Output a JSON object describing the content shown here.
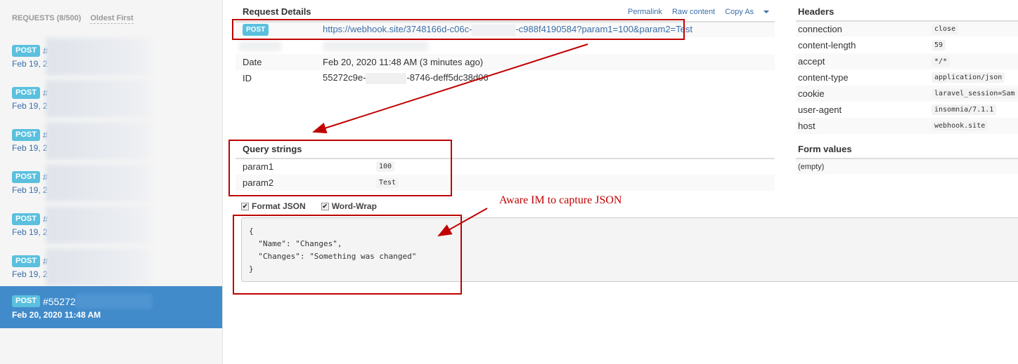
{
  "sidebar": {
    "title": "REQUESTS (8/500)",
    "sort_label": "Oldest First",
    "items": [
      {
        "method": "POST",
        "number": "#",
        "date": "Feb 19, 2"
      },
      {
        "method": "POST",
        "number": "#",
        "date": "Feb 19, 2"
      },
      {
        "method": "POST",
        "number": "#",
        "date": "Feb 19, 2"
      },
      {
        "method": "POST",
        "number": "#",
        "date": "Feb 19, 2"
      },
      {
        "method": "POST",
        "number": "#",
        "date": "Feb 19, 2"
      },
      {
        "method": "POST",
        "number": "#",
        "date": "Feb 19, 2"
      },
      {
        "method": "POST",
        "number": "#55272",
        "date": "Feb 20, 2020 11:48 AM",
        "active": true
      }
    ]
  },
  "request_details": {
    "title": "Request Details",
    "links": {
      "permalink": "Permalink",
      "raw_content": "Raw content",
      "copy_as": "Copy As"
    },
    "method": "POST",
    "url_prefix": "https://webhook.site/3748166d-c06c-",
    "url_suffix": "-c988f4190584?param1=100&param2=Test",
    "date_label": "Date",
    "date_value": "Feb 20, 2020 11:48 AM (3 minutes ago)",
    "id_label": "ID",
    "id_prefix": "55272c9e-",
    "id_suffix": "-8746-deff5dc38d06"
  },
  "query_strings": {
    "title": "Query strings",
    "rows": [
      {
        "key": "param1",
        "value": "100"
      },
      {
        "key": "param2",
        "value": "Test"
      }
    ]
  },
  "headers": {
    "title": "Headers",
    "rows": [
      {
        "key": "connection",
        "value": "close"
      },
      {
        "key": "content-length",
        "value": "59"
      },
      {
        "key": "accept",
        "value": "*/*"
      },
      {
        "key": "content-type",
        "value": "application/json"
      },
      {
        "key": "cookie",
        "value": "laravel_session=Sam"
      },
      {
        "key": "user-agent",
        "value": "insomnia/7.1.1"
      },
      {
        "key": "host",
        "value": "webhook.site"
      }
    ]
  },
  "form_values": {
    "title": "Form values",
    "empty": "(empty)"
  },
  "options": {
    "format_json": "Format JSON",
    "word_wrap": "Word-Wrap",
    "check_mark": "✔"
  },
  "body": "{\n  \"Name\": \"Changes\",\n  \"Changes\": \"Something was changed\"\n}",
  "annotation": {
    "text": "Aware IM to capture JSON",
    "color": "#c00000"
  }
}
